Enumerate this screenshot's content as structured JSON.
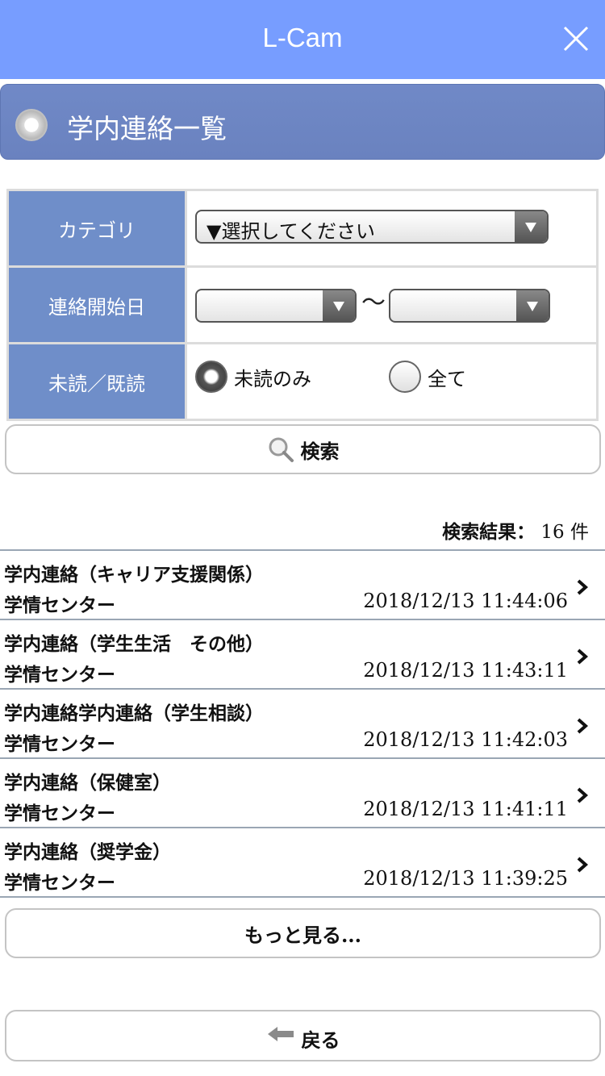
{
  "app": {
    "title": "L-Cam"
  },
  "page": {
    "title": "学内連絡一覧"
  },
  "form": {
    "category_label": "カテゴリ",
    "category_value": "▼選択してください",
    "date_label": "連絡開始日",
    "date_from": "",
    "date_to": "",
    "date_separator": "～",
    "read_label": "未読／既読",
    "radio_unread": "未読のみ",
    "radio_all": "全て",
    "selected": "unread"
  },
  "search": {
    "label": "検索",
    "icon": "magnifier-icon"
  },
  "results": {
    "label": "検索結果：",
    "count": "16",
    "unit": "件",
    "items": [
      {
        "title": "学内連絡（キャリア支援関係）",
        "sender": "学情センター",
        "date": "2018/12/13 11:44:06"
      },
      {
        "title": "学内連絡（学生生活　その他）",
        "sender": "学情センター",
        "date": "2018/12/13 11:43:11"
      },
      {
        "title": "学内連絡学内連絡（学生相談）",
        "sender": "学情センター",
        "date": "2018/12/13 11:42:03"
      },
      {
        "title": "学内連絡（保健室）",
        "sender": "学情センター",
        "date": "2018/12/13 11:41:11"
      },
      {
        "title": "学内連絡（奨学金）",
        "sender": "学情センター",
        "date": "2018/12/13 11:39:25"
      }
    ]
  },
  "more": {
    "label": "もっと見る..."
  },
  "back": {
    "label": "戻る",
    "icon": "back-arrow-icon"
  },
  "colors": {
    "topbar": "#779dff",
    "header": "#6a82bf",
    "label_cell": "#6f8ec9"
  }
}
